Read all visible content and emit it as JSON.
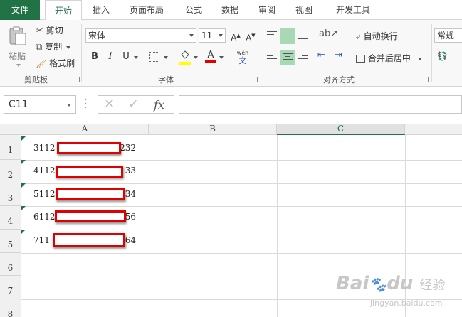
{
  "ribbon_tabs": [
    {
      "label": "文件"
    },
    {
      "label": "开始"
    },
    {
      "label": "插入"
    },
    {
      "label": "页面布局"
    },
    {
      "label": "公式"
    },
    {
      "label": "数据"
    },
    {
      "label": "审阅"
    },
    {
      "label": "视图"
    },
    {
      "label": "开发工具"
    }
  ],
  "clipboard": {
    "paste": "粘贴",
    "cut": "剪切",
    "copy": "复制",
    "format_painter": "格式刷",
    "group_label": "剪贴板"
  },
  "font": {
    "name": "宋体",
    "size": "11",
    "bold": "B",
    "italic": "I",
    "underline": "U",
    "wen": "wén",
    "group_label": "字体",
    "fill_color": "#ffff00",
    "font_color": "#e00000"
  },
  "alignment": {
    "wrap_text": "自动换行",
    "merge_center": "合并后居中",
    "group_label": "对齐方式"
  },
  "number": {
    "format": "常规"
  },
  "formula_bar": {
    "name_box": "C11",
    "fx": "fx",
    "formula": ""
  },
  "sheet": {
    "columns": [
      "A",
      "B",
      "C"
    ],
    "selected_column": "C",
    "rows": [
      "1",
      "2",
      "3",
      "4",
      "5",
      "6",
      "7",
      "8"
    ],
    "cells": [
      {
        "prefix": "3112",
        "suffix": "232"
      },
      {
        "prefix": "4112",
        "suffix": "33"
      },
      {
        "prefix": "5112",
        "suffix": "34"
      },
      {
        "prefix": "6112",
        "suffix": "56"
      },
      {
        "prefix": "711",
        "suffix": "64"
      }
    ]
  },
  "watermark": {
    "brand": "Bai",
    "brand2": "du",
    "jingyan": "经验",
    "url": "jingyan.baidu.com"
  },
  "colors": {
    "excel_green": "#217346",
    "redaction": "#e00000"
  }
}
